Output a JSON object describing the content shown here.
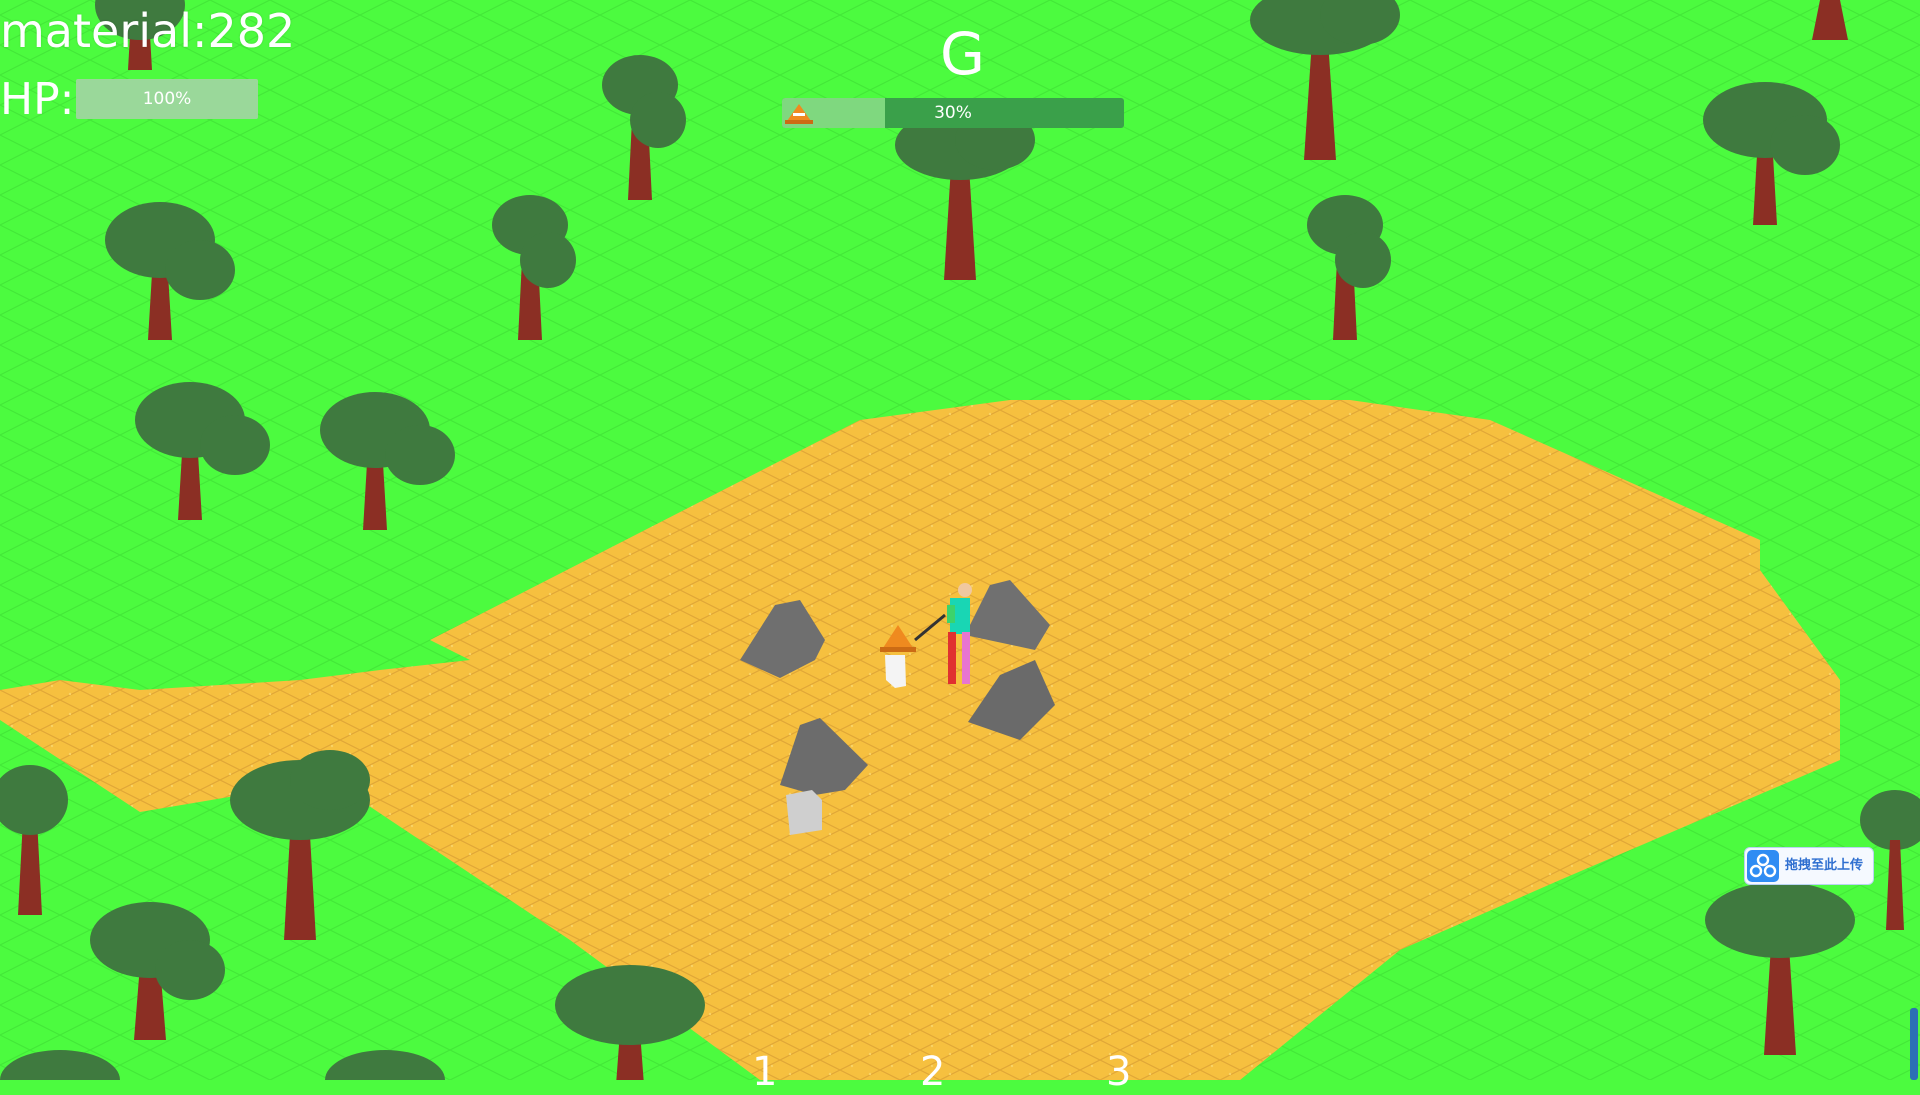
{
  "hud": {
    "material_text": "material:282",
    "hp_label": "HP:",
    "hp_text": "100%",
    "hp_value": 1.0,
    "hotkey_letter": "G",
    "progress_text": "30%",
    "progress_value": 0.3,
    "progress_icon": "cone-icon"
  },
  "hotbar": {
    "slots": [
      "1",
      "2",
      "3"
    ]
  },
  "upload_button": {
    "label": "拖拽至此上传",
    "icon": "cloud-share-icon"
  },
  "colors": {
    "grass": "#4cfb3f",
    "sand": "#f6c03f",
    "sand_grid": "#dca030",
    "tree_trunk": "#8b2f24",
    "tree_leaves": "#3f7a3f",
    "rock": "#6f6f6f",
    "hud_bar": "#3aa04a"
  }
}
